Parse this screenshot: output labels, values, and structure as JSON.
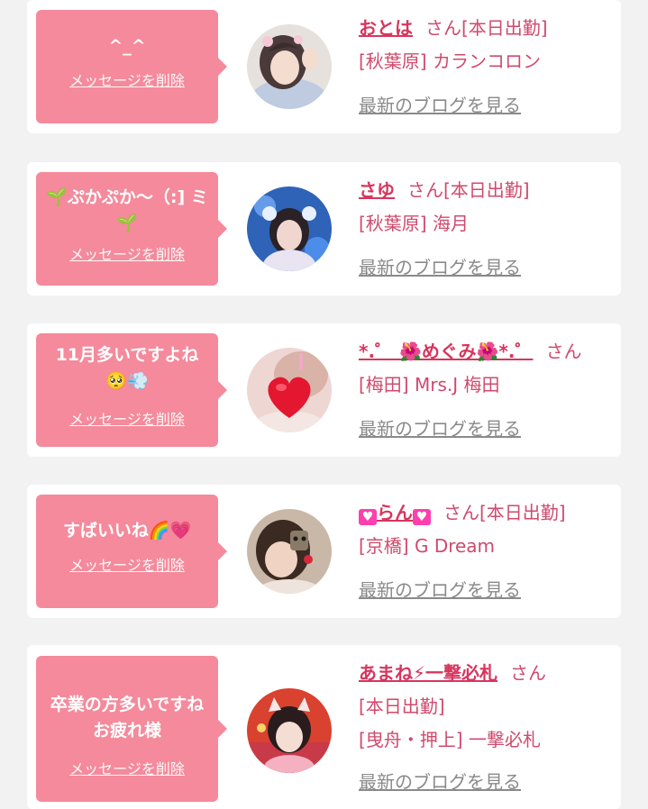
{
  "items": [
    {
      "message": "^_^",
      "delete_label": "メッセージを削除",
      "name": "おとは",
      "san": "さん",
      "status": "[本日出勤]",
      "shop": "[秋葉原] カランコロン",
      "blog_link": "最新のブログを見る"
    },
    {
      "message": "🌱ぷかぷか〜（:] ミ🌱",
      "delete_label": "メッセージを削除",
      "name": "さゆ",
      "san": "さん",
      "status": "[本日出勤]",
      "shop": "[秋葉原] 海月",
      "blog_link": "最新のブログを見る"
    },
    {
      "message": "11月多いですよね🥺💨",
      "delete_label": "メッセージを削除",
      "name": "*.゜ 🌺めぐみ🌺*.゜",
      "san": "さん",
      "status": "",
      "shop": "[梅田] Mrs.J 梅田",
      "blog_link": "最新のブログを見る"
    },
    {
      "message": "すばいいね🌈💗",
      "delete_label": "メッセージを削除",
      "name": "らん",
      "san": "さん",
      "status": "[本日出勤]",
      "shop": "[京橋] G Dream",
      "blog_link": "最新のブログを見る"
    },
    {
      "message": "卒業の方多いですねお疲れ様",
      "delete_label": "メッセージを削除",
      "name": "あまね⚡一撃必札",
      "san": "さん",
      "status": "[本日出勤]",
      "shop": "[曳舟・押上] 一撃必札",
      "blog_link": "最新のブログを見る"
    }
  ],
  "colors": {
    "bubble": "#f48a9b",
    "name": "#d8355d",
    "text": "#d04a6c",
    "link": "#8a8a8a",
    "background": "#f2f2f2"
  }
}
